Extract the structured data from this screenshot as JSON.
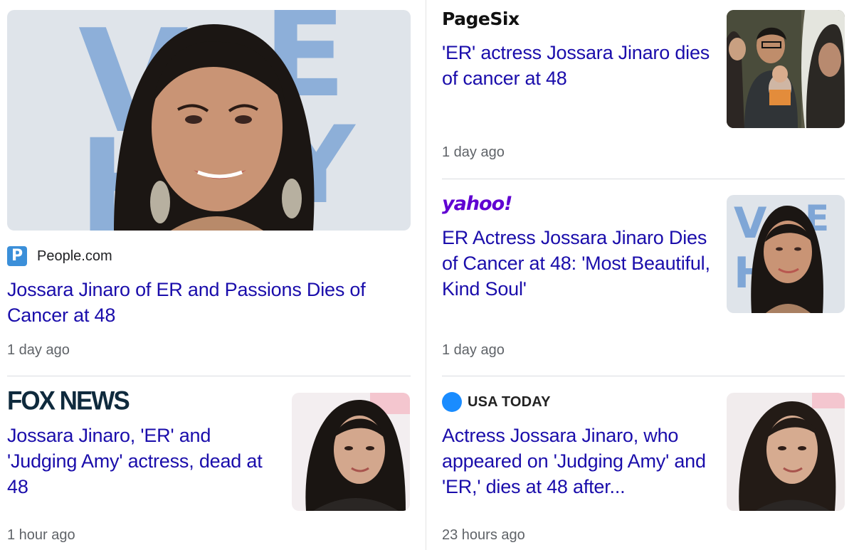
{
  "cards": {
    "people": {
      "source": "People.com",
      "source_icon_letter": "P",
      "headline": "Jossara Jinaro of ER and Passions Dies of Cancer at 48",
      "time": "1 day ago"
    },
    "pagesix": {
      "source": "PageSix",
      "headline": "'ER' actress Jossara Jinaro dies of cancer at 48",
      "time": "1 day ago"
    },
    "yahoo": {
      "source": "yahoo!",
      "headline": "ER Actress Jossara Jinaro Dies of Cancer at 48: 'Most Beautiful, Kind Soul'",
      "time": "1 day ago"
    },
    "foxnews": {
      "source": "FOX NEWS",
      "headline": "Jossara Jinaro, 'ER' and 'Judging Amy' actress, dead at 48",
      "time": "1 hour ago"
    },
    "usatoday": {
      "source": "USA TODAY",
      "headline": "Actress Jossara Jinaro, who appeared on 'Judging Amy' and 'ER,' dies at 48 after...",
      "time": "23 hours ago"
    }
  },
  "colors": {
    "headline": "#1a0dab",
    "meta": "#5f6368",
    "yahoo_purple": "#6001d2",
    "usa_today_blue": "#1a8cff",
    "people_blue": "#3b8fd9"
  }
}
